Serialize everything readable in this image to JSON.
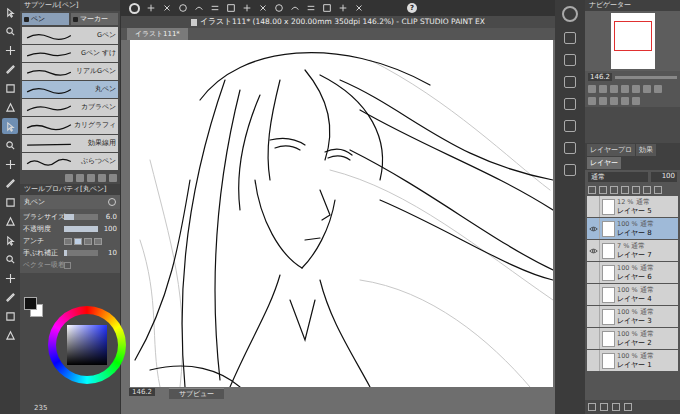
{
  "toolbox": [
    {
      "selected": false
    },
    {
      "selected": false
    },
    {
      "selected": false
    },
    {
      "selected": false
    },
    {
      "selected": false
    },
    {
      "selected": false
    },
    {
      "selected": true
    },
    {
      "selected": false
    },
    {
      "selected": false
    },
    {
      "selected": false
    },
    {
      "selected": false
    },
    {
      "selected": false
    },
    {
      "selected": false
    },
    {
      "selected": false
    },
    {
      "selected": false
    },
    {
      "selected": false
    },
    {
      "selected": false
    },
    {
      "selected": false
    }
  ],
  "subtool_panel": {
    "title": "サブツール[ペン]",
    "tabs": [
      {
        "label": "ペン",
        "selected": true
      },
      {
        "label": "マーカー",
        "selected": false
      }
    ],
    "items": [
      {
        "label": "Gペン",
        "selected": false
      },
      {
        "label": "Gペン すけ",
        "selected": false
      },
      {
        "label": "リアルGペン",
        "selected": false
      },
      {
        "label": "丸ペン",
        "selected": true
      },
      {
        "label": "カブラペン",
        "selected": false
      },
      {
        "label": "カリグラフィ",
        "selected": false
      },
      {
        "label": "効果線用",
        "selected": false
      },
      {
        "label": "ぶらつペン",
        "selected": false
      }
    ]
  },
  "tool_property": {
    "title": "ツールプロパティ[丸ペン]",
    "tool": "丸ペン",
    "rows": [
      {
        "kind": "slider",
        "label": "ブラシサイズ",
        "value": "6.0",
        "level": 0.3
      },
      {
        "kind": "slider",
        "label": "不透明度",
        "value": "100",
        "level": 1
      },
      {
        "kind": "aa",
        "label": "アンチ",
        "options": [
          {
            "selected": false
          },
          {
            "selected": true
          },
          {
            "selected": false
          },
          {
            "selected": false
          }
        ]
      },
      {
        "kind": "slider",
        "label": "手ぶれ補正",
        "value": "10",
        "level": 0.1
      },
      {
        "kind": "check",
        "label": "ベクター吸着",
        "checked": false,
        "disabled": true
      }
    ]
  },
  "color_panel": {
    "readout": "235"
  },
  "command_bar": {
    "help": "?"
  },
  "document": {
    "title": "イラスト111* (148.00 x 200.00mm 350dpi 146.2%) - CLIP STUDIO PAINT EX",
    "tab": "イラスト111*",
    "zoom": "146.2",
    "subview": "サブビュー"
  },
  "navigator": {
    "title": "ナビゲーター",
    "zoom": "146.2"
  },
  "layer_panel": {
    "tabs": [
      {
        "label": "レイヤープロ",
        "selected": false
      },
      {
        "label": "効果",
        "selected": false
      },
      {
        "label": "レイヤー",
        "selected": true
      }
    ],
    "blend": "通常",
    "opacity": "100",
    "layers": [
      {
        "opacity": "12 %",
        "blend": "通常",
        "name": "レイヤー 5",
        "selected": false,
        "visible": false
      },
      {
        "opacity": "100 %",
        "blend": "通常",
        "name": "レイヤー 8",
        "selected": true,
        "visible": true
      },
      {
        "opacity": "7 %",
        "blend": "通常",
        "name": "レイヤー 7",
        "selected": false,
        "visible": true
      },
      {
        "opacity": "100 %",
        "blend": "通常",
        "name": "レイヤー 6",
        "selected": false,
        "visible": false
      },
      {
        "opacity": "100 %",
        "blend": "通常",
        "name": "レイヤー 4",
        "selected": false,
        "visible": false
      },
      {
        "opacity": "100 %",
        "blend": "通常",
        "name": "レイヤー 3",
        "selected": false,
        "visible": false
      },
      {
        "opacity": "100 %",
        "blend": "通常",
        "name": "レイヤー 2",
        "selected": false,
        "visible": false
      },
      {
        "opacity": "100 %",
        "blend": "通常",
        "name": "レイヤー 1",
        "selected": false,
        "visible": false
      }
    ]
  }
}
